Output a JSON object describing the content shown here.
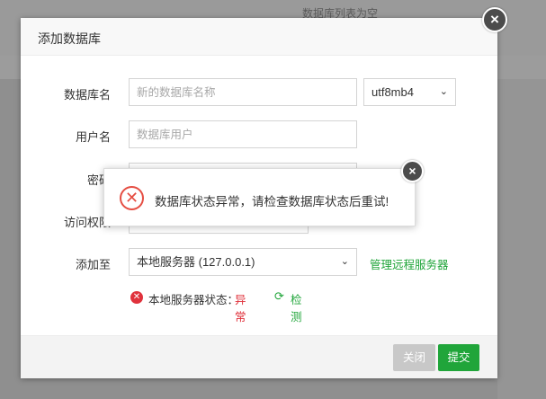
{
  "background": {
    "empty_text": "数据库列表为空"
  },
  "dialog": {
    "title": "添加数据库",
    "close_icon": "×"
  },
  "form": {
    "db_name_label": "数据库名",
    "db_name_placeholder": "新的数据库名称",
    "db_name_value": "",
    "charset_value": "utf8mb4",
    "user_label": "用户名",
    "user_placeholder": "数据库用户",
    "user_value": "",
    "password_label": "密码",
    "access_label": "访问权限",
    "add_to_label": "添加至",
    "server_value": "本地服务器 (127.0.0.1)",
    "manage_remote_link": "管理远程服务器"
  },
  "server_status": {
    "label": "本地服务器状态：",
    "value": "异常",
    "check_label": "检测",
    "error_color": "#e0323c",
    "check_color": "#20a53a"
  },
  "footer": {
    "close_label": "关闭",
    "submit_label": "提交",
    "submit_color": "#20a53a"
  },
  "toast": {
    "message": "数据库状态异常，请检查数据库状态后重试!",
    "icon": "error-circle-icon",
    "close_icon": "×"
  }
}
